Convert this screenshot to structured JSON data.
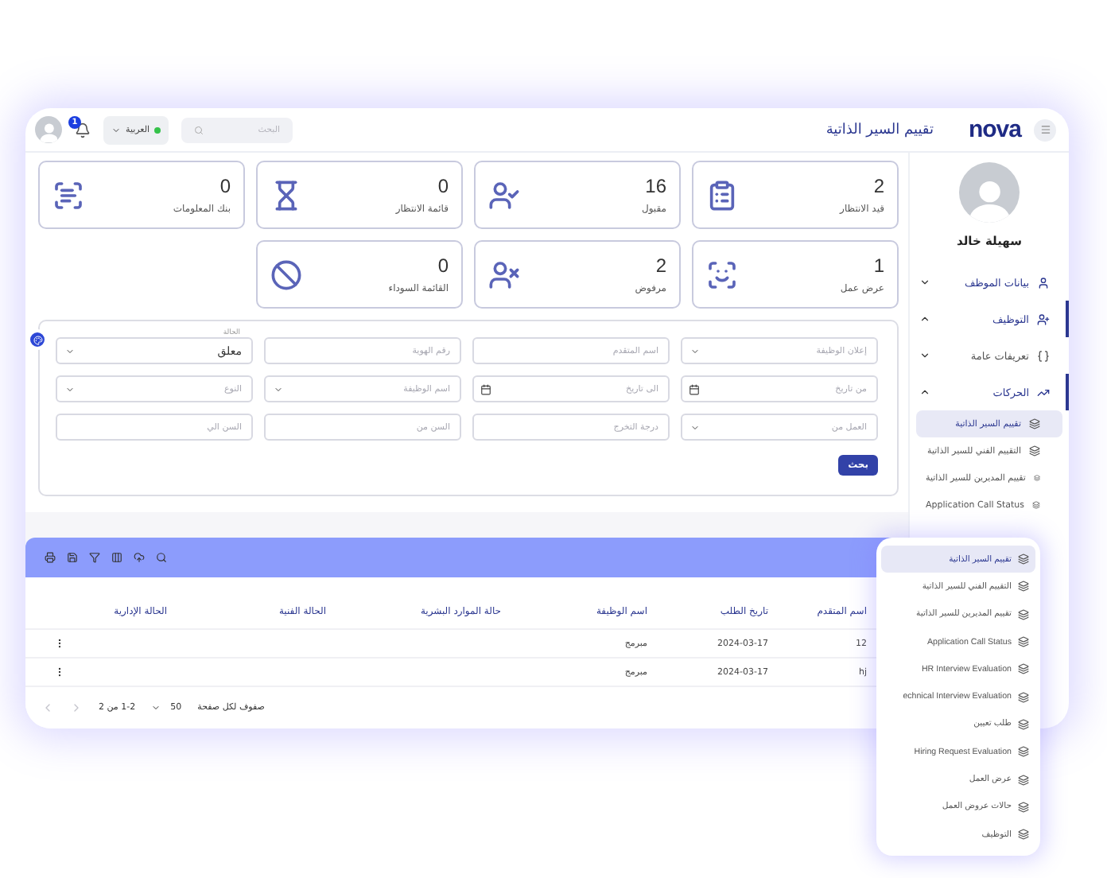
{
  "header": {
    "logo": "nova",
    "title": "تقييم السير الذاتية",
    "search": {
      "placeholder": "البحث"
    },
    "language": "العربية",
    "notifications": "1"
  },
  "sidebar": {
    "user_name": "سهيلة خالد",
    "nav": [
      {
        "label": "بيانات الموظف",
        "expanded": false,
        "active": false
      },
      {
        "label": "التوظيف",
        "expanded": true,
        "active": true,
        "children": [
          {
            "label": "تعريفات عامة",
            "expanded": false,
            "active": false
          },
          {
            "label": "الحركات",
            "expanded": true,
            "active": true,
            "children": [
              {
                "label": "تقييم السير الذاتية",
                "selected": true
              },
              {
                "label": "التقييم الفني للسير الذاتية",
                "selected": false
              },
              {
                "label": "تقييم المديرين للسير الذاتية",
                "selected": false
              },
              {
                "label": "Application Call Status",
                "selected": false
              }
            ]
          }
        ]
      }
    ]
  },
  "stats": [
    {
      "value": "2",
      "label": "قيد الانتظار"
    },
    {
      "value": "16",
      "label": "مقبول"
    },
    {
      "value": "0",
      "label": "قائمة الانتظار"
    },
    {
      "value": "0",
      "label": "بنك المعلومات"
    },
    {
      "value": "1",
      "label": "عرض عمل"
    },
    {
      "value": "2",
      "label": "مرفوض"
    },
    {
      "value": "0",
      "label": "القائمة السوداء"
    }
  ],
  "filters": {
    "fields": [
      {
        "kind": "select",
        "placeholder": "إعلان الوظيفة"
      },
      {
        "kind": "input",
        "placeholder": "اسم المتقدم"
      },
      {
        "kind": "input",
        "placeholder": "رقم الهوية"
      },
      {
        "kind": "select",
        "label": "الحالة",
        "value": "معلق"
      },
      {
        "kind": "date",
        "placeholder": "من تاريخ"
      },
      {
        "kind": "date",
        "placeholder": "الى تاريخ"
      },
      {
        "kind": "select",
        "placeholder": "اسم الوظيفة"
      },
      {
        "kind": "select",
        "placeholder": "النوع"
      },
      {
        "kind": "select",
        "placeholder": "العمل من"
      },
      {
        "kind": "input",
        "placeholder": "درجة التخرج"
      },
      {
        "kind": "input",
        "placeholder": "السن من"
      },
      {
        "kind": "input",
        "placeholder": "السن الي"
      }
    ],
    "search_button": "بحث"
  },
  "table": {
    "columns": [
      "اسم المتقدم",
      "تاريخ الطلب",
      "اسم الوظيفة",
      "حالة الموارد البشرية",
      "الحالة الفنية",
      "الحالة الإدارية"
    ],
    "rows": [
      {
        "cells": [
          "12",
          "2024-03-17",
          "مبرمج"
        ]
      },
      {
        "cells": [
          "hj",
          "2024-03-17",
          "مبرمج"
        ]
      }
    ],
    "footer": {
      "rows_per_page_label": "صفوف لكل صفحة",
      "rows_per_page": "50",
      "range": "1-2 من 2",
      "prev_disabled": true,
      "next_disabled": true
    }
  },
  "popup_menu": {
    "items": [
      {
        "label": "تقييم السير الذاتية",
        "selected": true
      },
      {
        "label": "التقييم الفني للسير الذاتية",
        "selected": false
      },
      {
        "label": "تقييم المديرين للسير الذاتية",
        "selected": false
      },
      {
        "label": "Application Call Status",
        "selected": false
      },
      {
        "label": "HR Interview Evaluation",
        "selected": false
      },
      {
        "label": "echnical Interview Evaluation",
        "selected": false
      },
      {
        "label": "طلب تعيين",
        "selected": false
      },
      {
        "label": "Hiring Request Evaluation",
        "selected": false
      },
      {
        "label": "عرض العمل",
        "selected": false
      },
      {
        "label": "حالات عروض العمل",
        "selected": false
      },
      {
        "label": "التوظيف",
        "selected": false
      }
    ]
  }
}
